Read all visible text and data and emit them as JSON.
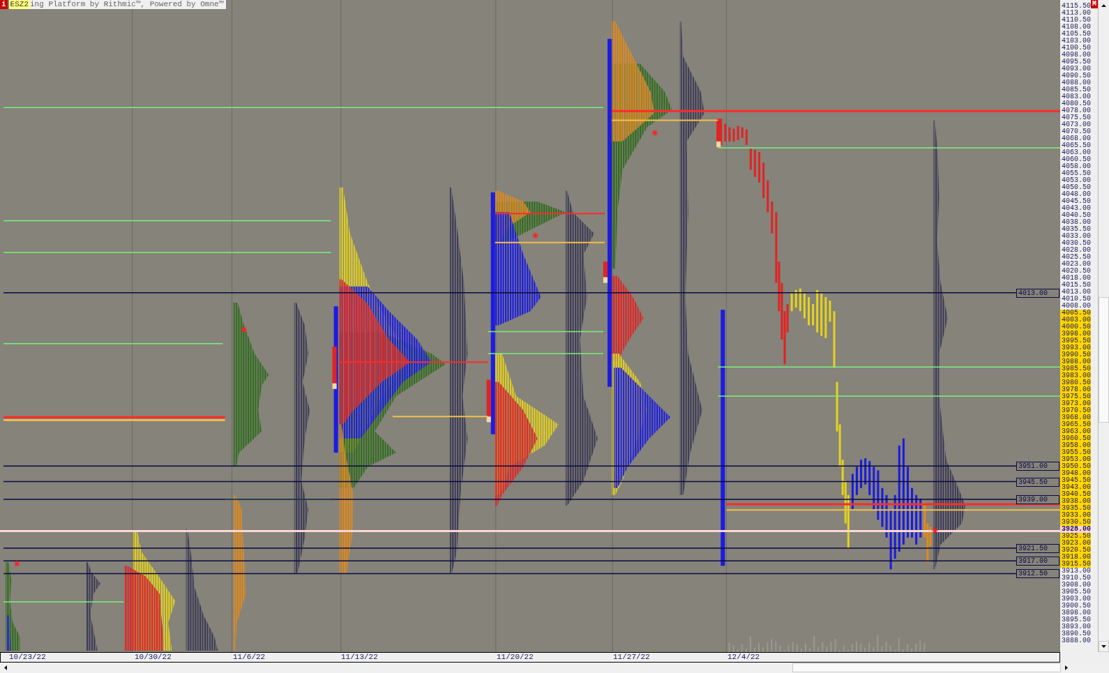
{
  "title": {
    "badge": "i",
    "symbol": "ESZ2",
    "text": "ing Platform by Rithmic™, Powered by Omne™"
  },
  "axis_badge": "M",
  "price_axis": [
    {
      "label": "4115.50",
      "kind": "plain"
    },
    {
      "label": "4113.00",
      "kind": "plain"
    },
    {
      "label": "4110.50",
      "kind": "plain"
    },
    {
      "label": "4108.00",
      "kind": "plain"
    },
    {
      "label": "4105.50",
      "kind": "plain"
    },
    {
      "label": "4103.00",
      "kind": "plain"
    },
    {
      "label": "4100.50",
      "kind": "plain"
    },
    {
      "label": "4098.00",
      "kind": "plain"
    },
    {
      "label": "4095.50",
      "kind": "plain"
    },
    {
      "label": "4093.00",
      "kind": "plain"
    },
    {
      "label": "4090.50",
      "kind": "plain"
    },
    {
      "label": "4088.00",
      "kind": "plain"
    },
    {
      "label": "4085.50",
      "kind": "plain"
    },
    {
      "label": "4083.00",
      "kind": "plain"
    },
    {
      "label": "4080.50",
      "kind": "plain"
    },
    {
      "label": "4078.00",
      "kind": "plain"
    },
    {
      "label": "4075.50",
      "kind": "plain"
    },
    {
      "label": "4073.00",
      "kind": "plain"
    },
    {
      "label": "4070.50",
      "kind": "plain"
    },
    {
      "label": "4068.00",
      "kind": "plain"
    },
    {
      "label": "4065.50",
      "kind": "plain"
    },
    {
      "label": "4063.00",
      "kind": "plain"
    },
    {
      "label": "4060.50",
      "kind": "plain"
    },
    {
      "label": "4058.00",
      "kind": "plain"
    },
    {
      "label": "4055.50",
      "kind": "plain"
    },
    {
      "label": "4053.00",
      "kind": "plain"
    },
    {
      "label": "4050.50",
      "kind": "plain"
    },
    {
      "label": "4048.00",
      "kind": "plain"
    },
    {
      "label": "4045.50",
      "kind": "plain"
    },
    {
      "label": "4043.00",
      "kind": "plain"
    },
    {
      "label": "4040.50",
      "kind": "plain"
    },
    {
      "label": "4038.00",
      "kind": "plain"
    },
    {
      "label": "4035.50",
      "kind": "plain"
    },
    {
      "label": "4033.00",
      "kind": "plain"
    },
    {
      "label": "4030.50",
      "kind": "plain"
    },
    {
      "label": "4028.00",
      "kind": "plain"
    },
    {
      "label": "4025.50",
      "kind": "plain"
    },
    {
      "label": "4023.00",
      "kind": "plain"
    },
    {
      "label": "4020.50",
      "kind": "plain"
    },
    {
      "label": "4018.00",
      "kind": "plain"
    },
    {
      "label": "4015.50",
      "kind": "plain"
    },
    {
      "label": "4013.00",
      "kind": "plain"
    },
    {
      "label": "4010.50",
      "kind": "plain"
    },
    {
      "label": "4008.00",
      "kind": "plain"
    },
    {
      "label": "4005.50",
      "kind": "value"
    },
    {
      "label": "4003.00",
      "kind": "value"
    },
    {
      "label": "4000.50",
      "kind": "value"
    },
    {
      "label": "3998.00",
      "kind": "value"
    },
    {
      "label": "3995.50",
      "kind": "value"
    },
    {
      "label": "3993.00",
      "kind": "value"
    },
    {
      "label": "3990.50",
      "kind": "value"
    },
    {
      "label": "3988.00",
      "kind": "value"
    },
    {
      "label": "3985.50",
      "kind": "value"
    },
    {
      "label": "3983.00",
      "kind": "value"
    },
    {
      "label": "3980.50",
      "kind": "value"
    },
    {
      "label": "3978.00",
      "kind": "value"
    },
    {
      "label": "3975.50",
      "kind": "value"
    },
    {
      "label": "3973.00",
      "kind": "value"
    },
    {
      "label": "3970.50",
      "kind": "value"
    },
    {
      "label": "3968.00",
      "kind": "value"
    },
    {
      "label": "3965.50",
      "kind": "value"
    },
    {
      "label": "3963.00",
      "kind": "value"
    },
    {
      "label": "3960.50",
      "kind": "value"
    },
    {
      "label": "3958.00",
      "kind": "value"
    },
    {
      "label": "3955.50",
      "kind": "value"
    },
    {
      "label": "3953.00",
      "kind": "value"
    },
    {
      "label": "3950.50",
      "kind": "value"
    },
    {
      "label": "3948.00",
      "kind": "value"
    },
    {
      "label": "3945.50",
      "kind": "value"
    },
    {
      "label": "3943.00",
      "kind": "value"
    },
    {
      "label": "3940.50",
      "kind": "value"
    },
    {
      "label": "3938.00",
      "kind": "value"
    },
    {
      "label": "3935.50",
      "kind": "value"
    },
    {
      "label": "3933.00",
      "kind": "value"
    },
    {
      "label": "3930.50",
      "kind": "value"
    },
    {
      "label": "3928.00",
      "kind": "current"
    },
    {
      "label": "3925.50",
      "kind": "value"
    },
    {
      "label": "3923.00",
      "kind": "value"
    },
    {
      "label": "3920.50",
      "kind": "value"
    },
    {
      "label": "3918.00",
      "kind": "value"
    },
    {
      "label": "3915.50",
      "kind": "value"
    },
    {
      "label": "3913.00",
      "kind": "plain"
    },
    {
      "label": "3910.50",
      "kind": "plain"
    },
    {
      "label": "3908.00",
      "kind": "plain"
    },
    {
      "label": "3905.50",
      "kind": "plain"
    },
    {
      "label": "3903.00",
      "kind": "plain"
    },
    {
      "label": "3900.50",
      "kind": "plain"
    },
    {
      "label": "3898.00",
      "kind": "plain"
    },
    {
      "label": "3895.50",
      "kind": "plain"
    },
    {
      "label": "3893.00",
      "kind": "plain"
    },
    {
      "label": "3890.50",
      "kind": "plain"
    },
    {
      "label": "3888.00",
      "kind": "plain"
    }
  ],
  "levels": [
    {
      "label": "4013.00"
    },
    {
      "label": "3951.00"
    },
    {
      "label": "3945.50"
    },
    {
      "label": "3939.00"
    },
    {
      "label": "3921.50"
    },
    {
      "label": "3917.00"
    },
    {
      "label": "3912.50"
    }
  ],
  "dates": [
    "10/23/22",
    "10/30/22",
    "11/6/22",
    "11/13/22",
    "11/20/22",
    "11/27/22",
    "12/4/22"
  ]
}
